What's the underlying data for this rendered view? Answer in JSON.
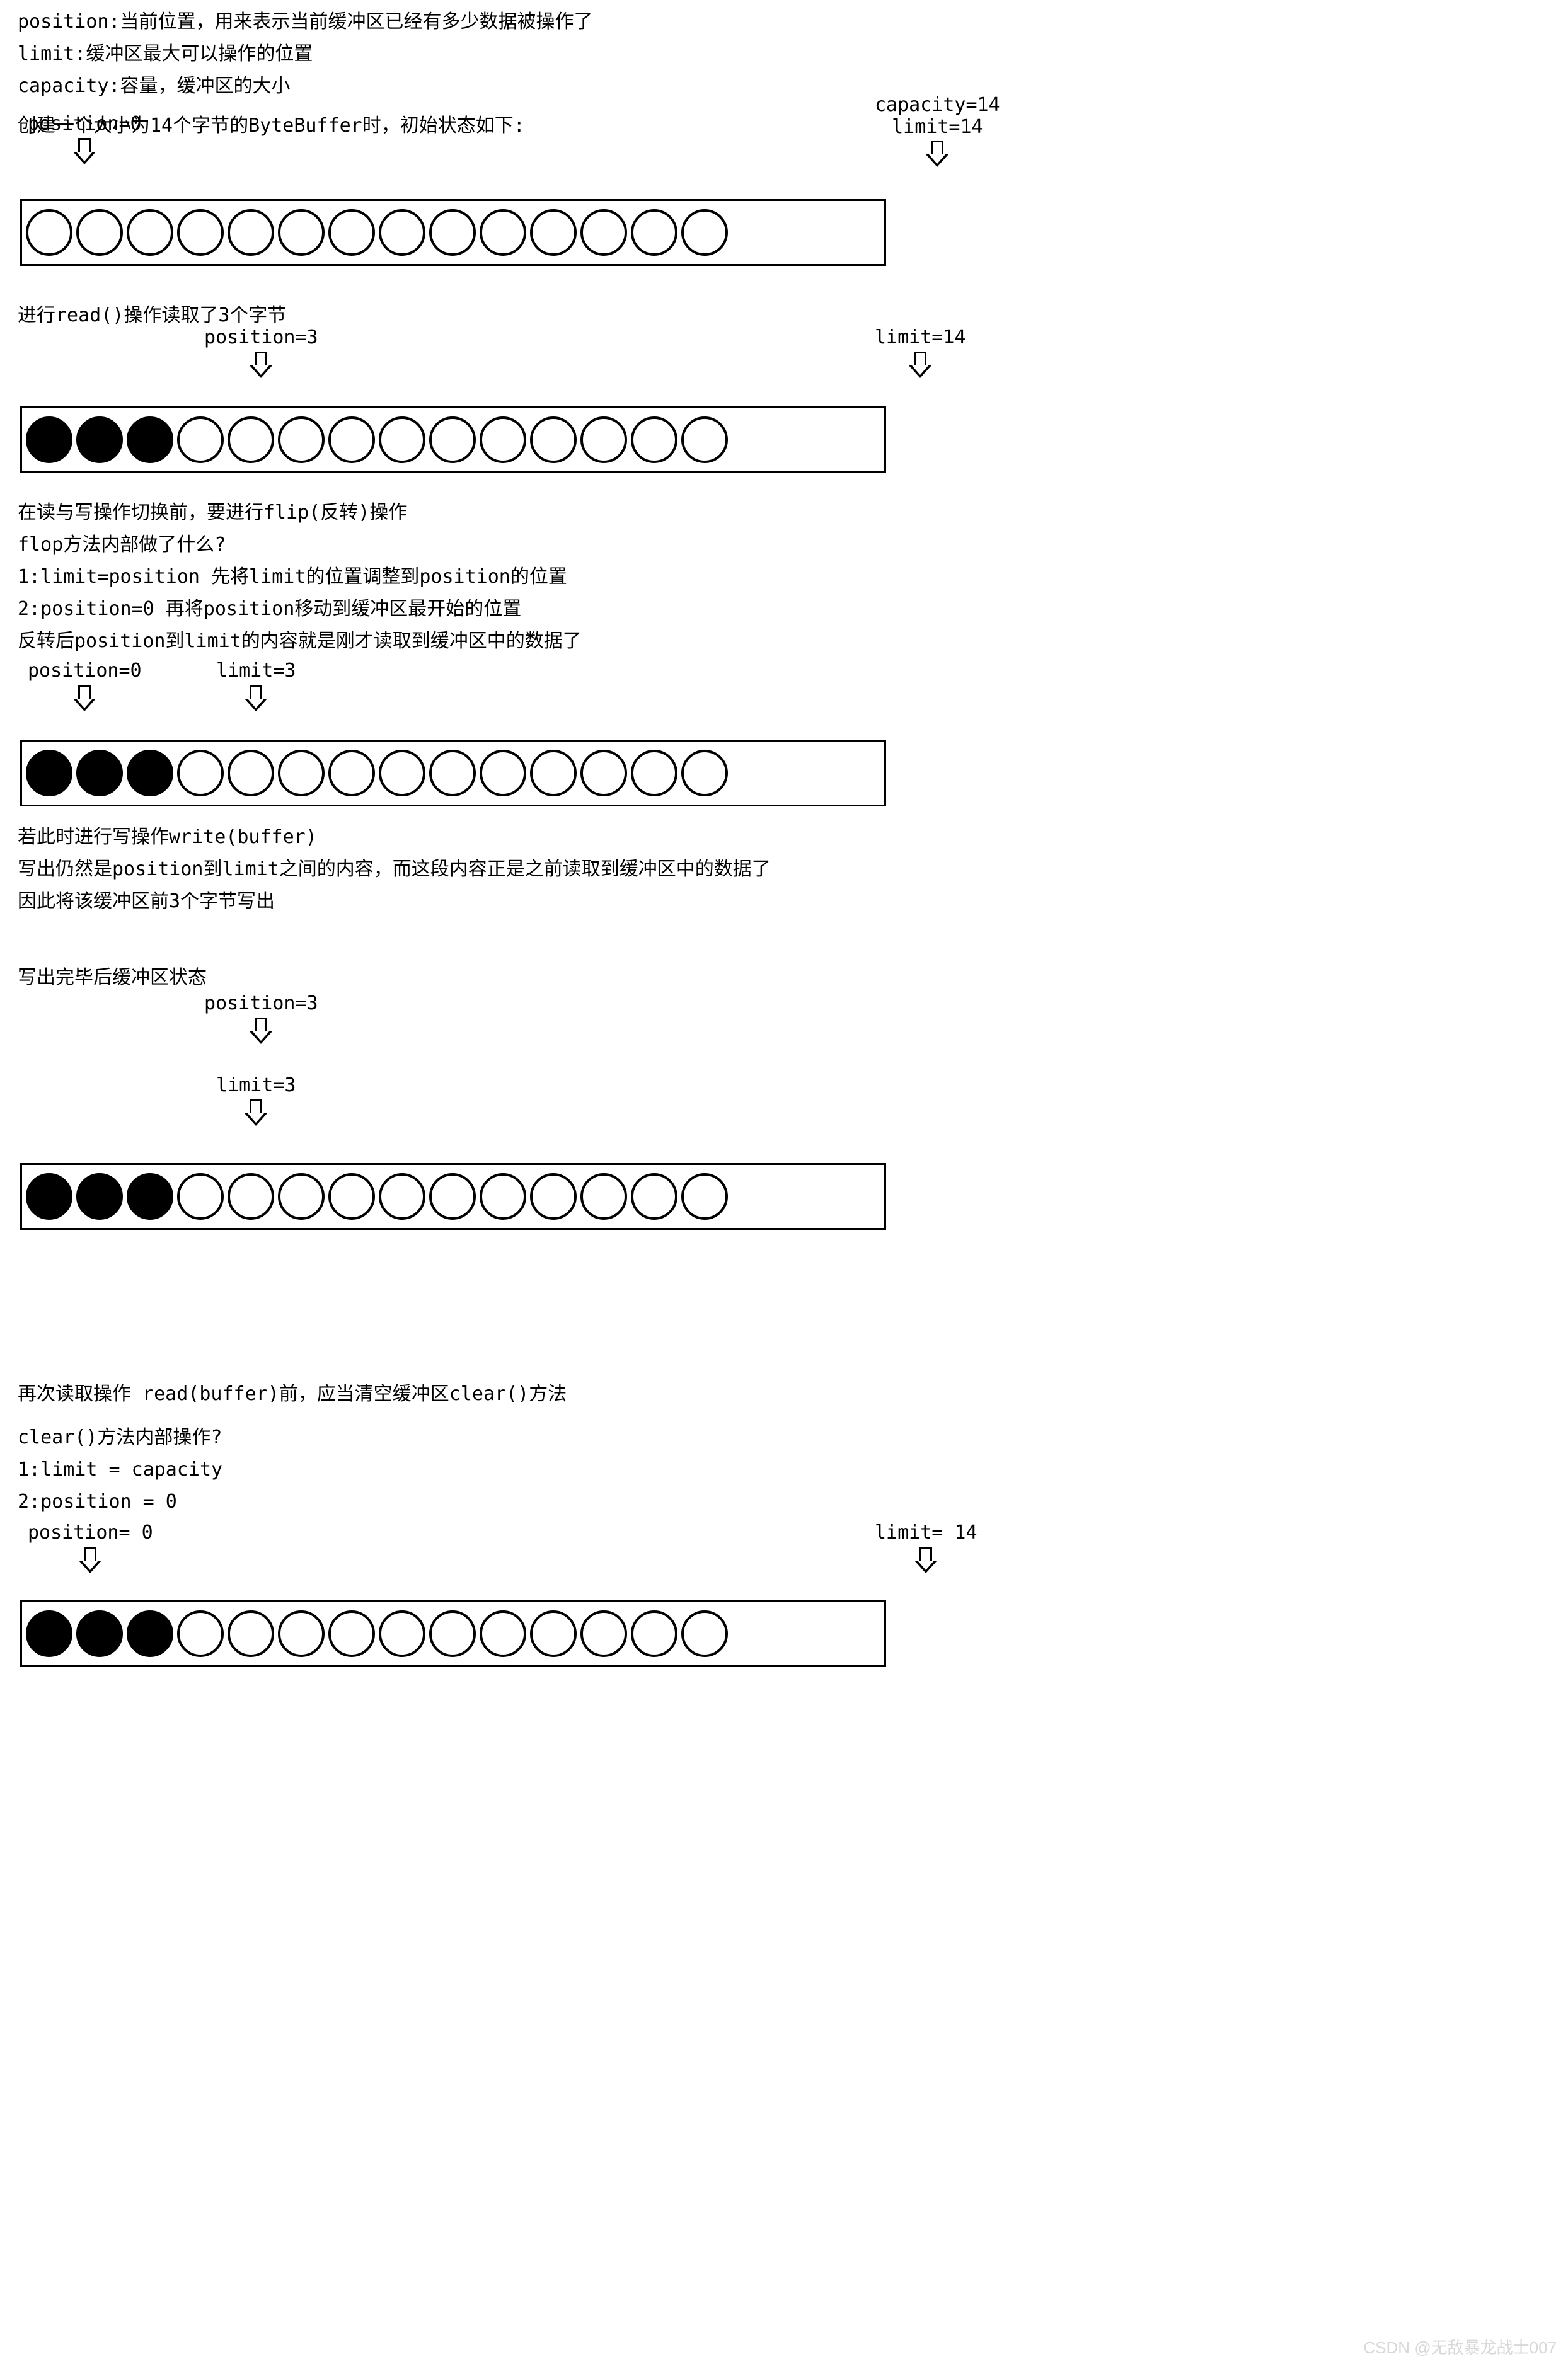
{
  "intro": {
    "l1": "position:当前位置，用来表示当前缓冲区已经有多少数据被操作了",
    "l2": "limit:缓冲区最大可以操作的位置",
    "l3": "capacity:容量，缓冲区的大小"
  },
  "sec1": {
    "desc": "创建一个大小为14个字节的ByteBuffer时，初始状态如下:",
    "pos": "position=0",
    "cap": "capacity=14",
    "lim": "limit=14",
    "filled": 0,
    "capacity": 14
  },
  "sec2": {
    "desc": "进行read()操作读取了3个字节",
    "pos": "position=3",
    "lim": "limit=14",
    "filled": 3,
    "capacity": 14
  },
  "sec3": {
    "l1": "在读与写操作切换前，要进行flip(反转)操作",
    "l2": "flop方法内部做了什么?",
    "l3": "1:limit=position 先将limit的位置调整到position的位置",
    "l4": "2:position=0 再将position移动到缓冲区最开始的位置",
    "l5": "反转后position到limit的内容就是刚才读取到缓冲区中的数据了",
    "pos": "position=0",
    "lim": "limit=3",
    "filled": 3,
    "capacity": 14
  },
  "sec3b": {
    "l1": "若此时进行写操作write(buffer)",
    "l2": "写出仍然是position到limit之间的内容，而这段内容正是之前读取到缓冲区中的数据了",
    "l3": "因此将该缓冲区前3个字节写出"
  },
  "sec4": {
    "desc": "写出完毕后缓冲区状态",
    "pos": "position=3",
    "lim": "limit=3",
    "filled": 3,
    "capacity": 14
  },
  "sec5": {
    "l1": "再次读取操作 read(buffer)前，应当清空缓冲区clear()方法",
    "l2": "clear()方法内部操作?",
    "l3": "1:limit = capacity",
    "l4": "2:position = 0",
    "pos": "position= 0",
    "lim": "limit= 14",
    "filled": 3,
    "capacity": 14
  },
  "watermark": "CSDN @无敌暴龙战士007"
}
